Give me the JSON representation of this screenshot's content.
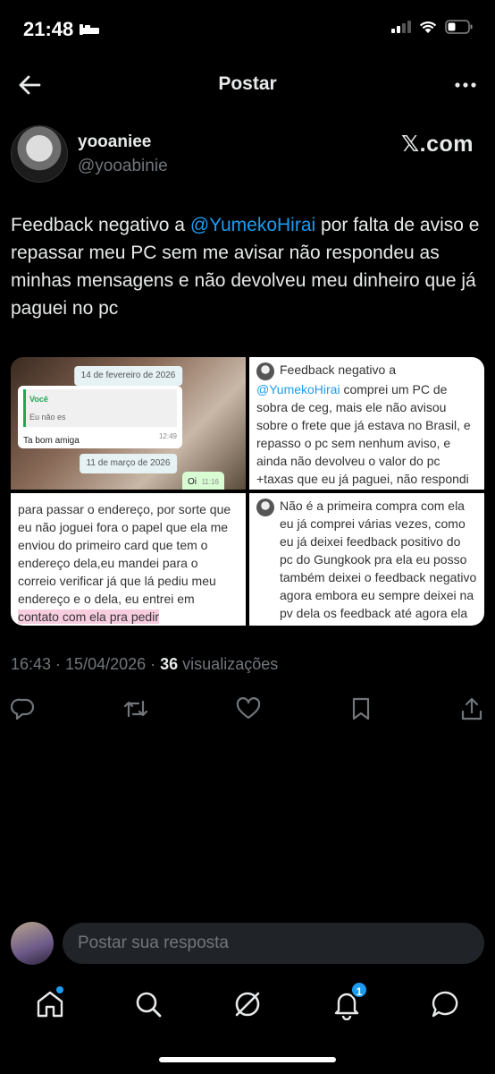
{
  "status_bar": {
    "time": "21:48",
    "icons": [
      "sleep-icon",
      "signal-icon",
      "wifi-icon",
      "battery-icon"
    ]
  },
  "header": {
    "title": "Postar"
  },
  "author": {
    "name": "yooaniee",
    "handle": "@yooabinie",
    "source_label": "𝕏.com"
  },
  "tweet": {
    "text_before": "Feedback negativo a ",
    "mention": "@YumekoHirai",
    "text_after": " por falta de aviso e repassar meu PC sem me avisar não respondeu as minhas mensagens e não devolveu meu dinheiro que já paguei no pc"
  },
  "media": {
    "cell1": {
      "date1": "14 de fevereiro de 2026",
      "quote_sender": "Você",
      "quote_text": "Eu não es",
      "message": "Ta bom amiga",
      "message_time": "12:49",
      "date2": "11 de março de 2026",
      "reply": "Oi",
      "reply_time": "11:16"
    },
    "cell2": {
      "line_start": "Feedback negativo a",
      "mention": "@YumekoHirai",
      "body_after_mention": " comprei um PC de sobra de ceg, mais ele não avisou sobre o frete que já estava no Brasil, e repasso o pc sem nenhum aviso, e ainda não devolveu o valor do pc +taxas que eu já paguei, não respondi nenhuma mensagem+++"
    },
    "cell3": {
      "body": "para passar o endereço, por sorte que eu não joguei fora o papel que ela me enviou do primeiro card que tem o endereço dela,eu mandei para o correio verificar  já que lá pediu meu endereço e o dela, eu entrei em ",
      "highlight": "contato com ela pra pedir"
    },
    "cell4": {
      "body": "Não é a primeira compra com ela eu já comprei várias vezes, como eu já deixei feedback positivo do pc do Gungkook pra ela eu posso também deixei o feedback negativo agora embora eu sempre deixei na pv dela os feedback até agora ela não me respondeu"
    }
  },
  "meta": {
    "time": "16:43",
    "separator1": " · ",
    "date": "15/04/2026",
    "separator2": " · ",
    "views_count": "36",
    "views_label": " visualizações"
  },
  "actions": [
    "reply-icon",
    "retweet-icon",
    "like-icon",
    "bookmark-icon",
    "share-icon"
  ],
  "reply": {
    "placeholder": "Postar sua resposta"
  },
  "tabbar": {
    "items": [
      "home-icon",
      "search-icon",
      "grok-icon",
      "notifications-icon",
      "messages-icon"
    ],
    "notification_count": "1"
  },
  "colors": {
    "accent": "#1d9bf0",
    "background": "#000000",
    "text": "#e7e9ea",
    "muted": "#71767b"
  }
}
